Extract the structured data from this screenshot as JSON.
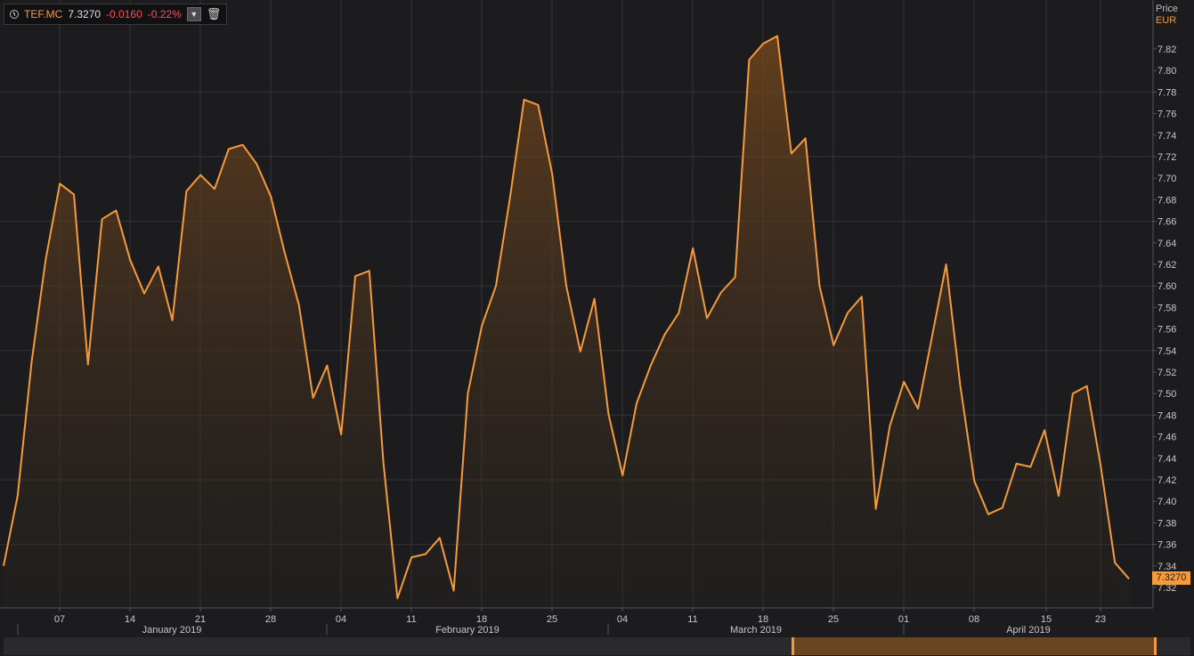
{
  "legend": {
    "symbol": "TEF.MC",
    "last": "7.3270",
    "change": "-0.0160",
    "change_pct": "-0.22%",
    "dropdown_icon": "chevron-down-icon",
    "delete_icon": "trash-icon"
  },
  "axis_header": {
    "label": "Price",
    "currency": "EUR"
  },
  "current_price_label": "7.3270",
  "colors": {
    "line": "#f59b3c",
    "background": "#1c1c1e",
    "grid": "#333336",
    "negative": "#ff4d5a"
  },
  "chart_data": {
    "type": "area",
    "title": "",
    "xlabel": "",
    "ylabel": "Price",
    "ylim": [
      7.3,
      7.84
    ],
    "grid": true,
    "y_ticks": [
      "7.32",
      "7.34",
      "7.36",
      "7.38",
      "7.40",
      "7.42",
      "7.44",
      "7.46",
      "7.48",
      "7.50",
      "7.52",
      "7.54",
      "7.56",
      "7.58",
      "7.60",
      "7.62",
      "7.64",
      "7.66",
      "7.68",
      "7.70",
      "7.72",
      "7.74",
      "7.76",
      "7.78",
      "7.80",
      "7.82"
    ],
    "x_ticks": [
      "07",
      "14",
      "21",
      "28",
      "04",
      "11",
      "18",
      "25",
      "04",
      "11",
      "18",
      "25",
      "01",
      "08",
      "15",
      "23"
    ],
    "month_labels": [
      "January 2019",
      "February 2019",
      "March 2019",
      "April 2019"
    ],
    "series": [
      {
        "values": [
          7.34,
          7.405,
          7.53,
          7.625,
          7.695,
          7.685,
          7.527,
          7.662,
          7.67,
          7.624,
          7.593,
          7.618,
          7.568,
          7.688,
          7.703,
          7.69,
          7.727,
          7.731,
          7.713,
          7.683,
          7.63,
          7.582,
          7.496,
          7.526,
          7.462,
          7.609,
          7.614,
          7.436,
          7.31,
          7.348,
          7.351,
          7.366,
          7.317,
          7.5,
          7.563,
          7.6,
          7.682,
          7.773,
          7.768,
          7.704,
          7.6,
          7.539,
          7.588,
          7.481,
          7.424,
          7.491,
          7.526,
          7.555,
          7.575,
          7.635,
          7.57,
          7.594,
          7.608,
          7.81,
          7.825,
          7.832,
          7.723,
          7.737,
          7.6,
          7.545,
          7.575,
          7.59,
          7.393,
          7.47,
          7.511,
          7.486,
          7.553,
          7.62,
          7.508,
          7.419,
          7.388,
          7.394,
          7.435,
          7.432,
          7.466,
          7.405,
          7.5,
          7.507,
          7.432,
          7.343,
          7.328
        ]
      }
    ]
  }
}
